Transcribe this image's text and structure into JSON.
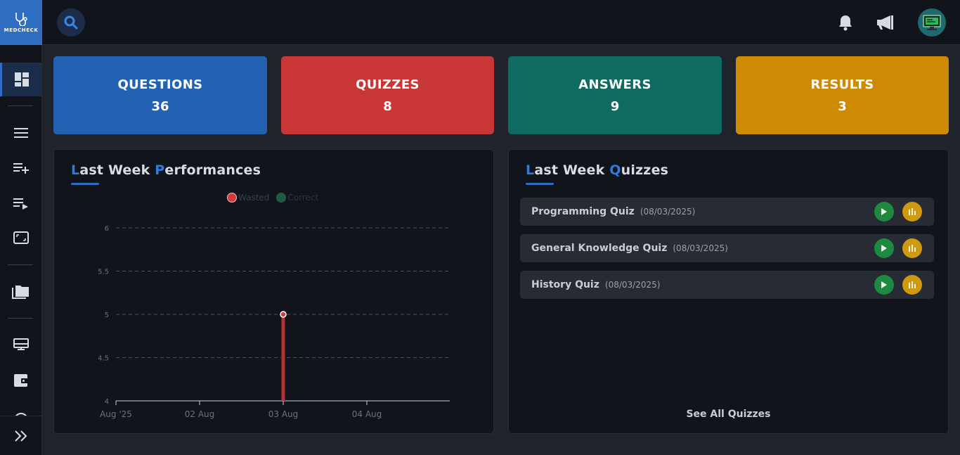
{
  "logo": {
    "text": "MEDCHECK"
  },
  "sidebar": {
    "items": [
      {
        "icon": "dashboard-icon"
      },
      {
        "icon": "list-icon"
      },
      {
        "icon": "playlist-add-icon"
      },
      {
        "icon": "playlist-play-icon"
      },
      {
        "icon": "monitor-icon"
      },
      {
        "icon": "folders-icon"
      },
      {
        "icon": "card-icon"
      },
      {
        "icon": "wallet-icon"
      },
      {
        "icon": "target-icon"
      }
    ],
    "expand_icon": "double-chevron-right-icon"
  },
  "topbar": {
    "search_icon": "search-icon",
    "notification_icon": "bell-icon",
    "announce_icon": "megaphone-icon",
    "avatar_icon": "monitor-avatar-icon"
  },
  "stats": [
    {
      "title": "QUESTIONS",
      "value": "36",
      "color": "#2361b3"
    },
    {
      "title": "QUIZZES",
      "value": "8",
      "color": "#c83637"
    },
    {
      "title": "ANSWERS",
      "value": "9",
      "color": "#0f6a60"
    },
    {
      "title": "RESULTS",
      "value": "3",
      "color": "#cc8a05"
    }
  ],
  "performance": {
    "title_first": "L",
    "title_rest1": "ast Week ",
    "title_second": "P",
    "title_rest2": "erformances"
  },
  "chart_data": {
    "type": "line",
    "title": "Last Week Performances",
    "categories": [
      "Aug '25",
      "02 Aug",
      "03 Aug",
      "04 Aug"
    ],
    "series": [
      {
        "name": "Wasted",
        "color": "#d23b3b",
        "values": [
          null,
          null,
          5,
          null
        ]
      },
      {
        "name": "Correct",
        "color": "#1e5a3c",
        "values": [
          null,
          null,
          null,
          null
        ]
      }
    ],
    "ylim": [
      4,
      6
    ],
    "yticks": [
      "4",
      "4.5",
      "5",
      "5.5",
      "6"
    ],
    "grid": true,
    "legend": "top-center"
  },
  "quizzes": {
    "title_first": "L",
    "title_rest1": "ast Week ",
    "title_second": "Q",
    "title_rest2": "uizzes",
    "items": [
      {
        "name": "Programming Quiz",
        "date": "(08/03/2025)"
      },
      {
        "name": "General Knowledge Quiz",
        "date": "(08/03/2025)"
      },
      {
        "name": "History Quiz",
        "date": "(08/03/2025)"
      }
    ],
    "see_all": "See All Quizzes",
    "play_icon": "play-icon",
    "stats_icon": "bar-chart-icon"
  }
}
